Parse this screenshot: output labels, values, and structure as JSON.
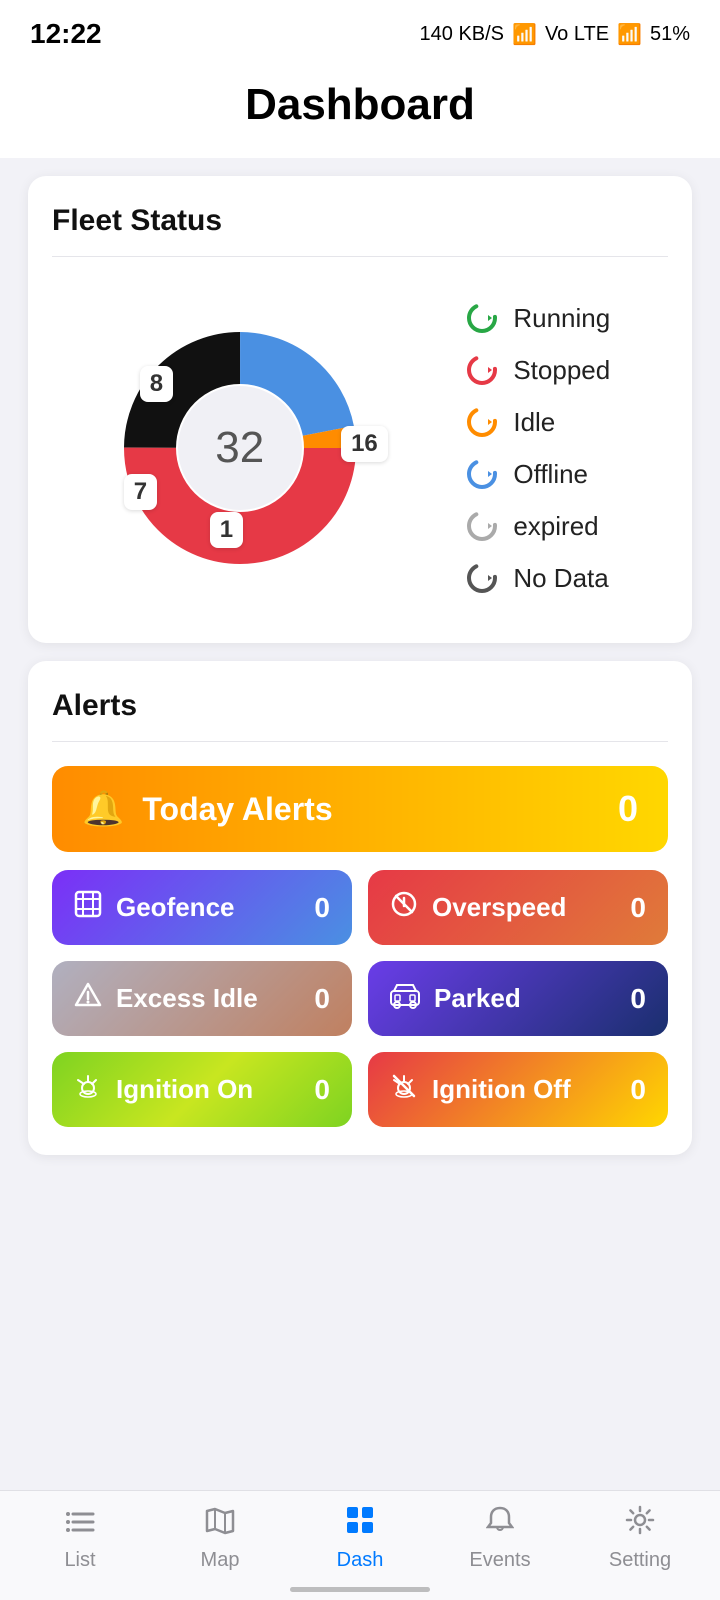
{
  "statusBar": {
    "time": "12:22",
    "network": "140 KB/S",
    "battery": "51%"
  },
  "header": {
    "title": "Dashboard"
  },
  "fleetStatus": {
    "title": "Fleet Status",
    "total": "32",
    "segments": [
      {
        "label": "Running",
        "value": 16,
        "color": "#e63946",
        "legendColor": "#28a745"
      },
      {
        "label": "Stopped",
        "value": 8,
        "color": "#111111",
        "legendColor": "#e63946"
      },
      {
        "label": "Idle",
        "value": 7,
        "color": "#4a90e2",
        "legendColor": "#ff8c00"
      },
      {
        "label": "Offline",
        "value": 0,
        "color": "#4a90e2",
        "legendColor": "#4a90e2"
      },
      {
        "label": "expired",
        "value": 0,
        "color": "#aaaaaa",
        "legendColor": "#aaaaaa"
      },
      {
        "label": "No Data",
        "value": 1,
        "color": "#ff8c00",
        "legendColor": "#555555"
      }
    ],
    "labels": [
      {
        "text": "8",
        "class": "label-8"
      },
      {
        "text": "16",
        "class": "label-16"
      },
      {
        "text": "7",
        "class": "label-7"
      },
      {
        "text": "1",
        "class": "label-1"
      }
    ]
  },
  "alerts": {
    "title": "Alerts",
    "todayLabel": "Today Alerts",
    "todayCount": "0",
    "items": [
      {
        "id": "geofence",
        "label": "Geofence",
        "count": "0",
        "icon": "⊞",
        "class": "btn-geofence"
      },
      {
        "id": "overspeed",
        "label": "Overspeed",
        "count": "0",
        "icon": "⊘",
        "class": "btn-overspeed"
      },
      {
        "id": "excessidle",
        "label": "Excess Idle",
        "count": "0",
        "icon": "🔔",
        "class": "btn-excessidle"
      },
      {
        "id": "parked",
        "label": "Parked",
        "count": "0",
        "icon": "🚌",
        "class": "btn-parked"
      },
      {
        "id": "ignitionon",
        "label": "Ignition On",
        "count": "0",
        "icon": "🗝",
        "class": "btn-ignitionon"
      },
      {
        "id": "ignitionoff",
        "label": "Ignition Off",
        "count": "0",
        "icon": "✂",
        "class": "btn-ignitionoff"
      }
    ]
  },
  "bottomNav": {
    "items": [
      {
        "id": "list",
        "label": "List",
        "icon": "≡",
        "active": false
      },
      {
        "id": "map",
        "label": "Map",
        "icon": "🗺",
        "active": false
      },
      {
        "id": "dash",
        "label": "Dash",
        "icon": "⊞",
        "active": true
      },
      {
        "id": "events",
        "label": "Events",
        "icon": "🔔",
        "active": false
      },
      {
        "id": "setting",
        "label": "Setting",
        "icon": "⚙",
        "active": false
      }
    ]
  }
}
